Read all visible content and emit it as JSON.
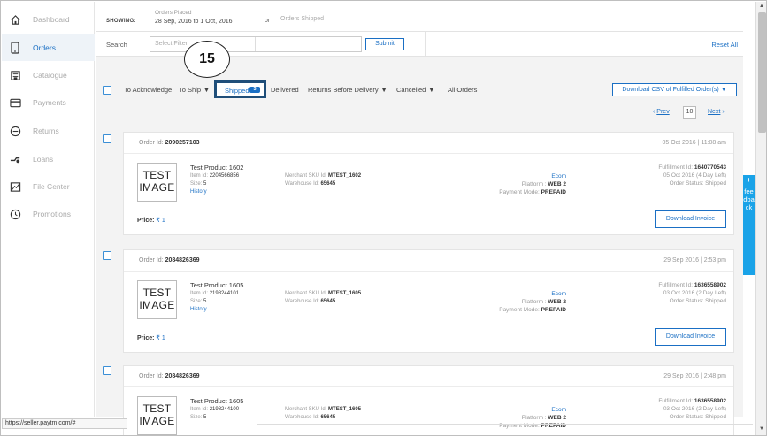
{
  "sidebar": {
    "items": [
      {
        "label": "Dashboard",
        "icon": "home-icon"
      },
      {
        "label": "Orders",
        "icon": "phone-icon",
        "active": true
      },
      {
        "label": "Catalogue",
        "icon": "catalogue-icon"
      },
      {
        "label": "Payments",
        "icon": "card-icon"
      },
      {
        "label": "Returns",
        "icon": "returns-icon"
      },
      {
        "label": "Loans",
        "icon": "loans-icon"
      },
      {
        "label": "File Center",
        "icon": "file-icon"
      },
      {
        "label": "Promotions",
        "icon": "clock-icon"
      }
    ]
  },
  "filters": {
    "showing_label": "SHOWING:",
    "orders_placed_label": "Orders Placed",
    "orders_placed_value": "28 Sep, 2016 to 1 Oct, 2016",
    "or_label": "or",
    "orders_shipped_label": "Orders Shipped"
  },
  "search": {
    "label": "Search",
    "placeholder": "Select Filter",
    "submit_label": "Submit",
    "reset_label": "Reset All"
  },
  "tabs": {
    "to_acknowledge": "To Acknowledge",
    "to_ship": "To Ship",
    "shipped": "Shipped",
    "shipped_count": "3",
    "delivered": "Delivered",
    "returns_before_delivery": "Returns Before Delivery",
    "cancelled": "Cancelled",
    "all_orders": "All Orders",
    "download_csv": "Download CSV of Fulfilled Order(s)"
  },
  "step_marker": "15",
  "pager": {
    "prev": "Prev",
    "page": "10",
    "next": "Next"
  },
  "orders": [
    {
      "order_id_label": "Order Id:",
      "order_id": "2090257103",
      "date": "05 Oct 2016 | 11:08 am",
      "image_line1": "TEST",
      "image_line2": "IMAGE",
      "product_name": "Test Product 1602",
      "item_id_label": "Item Id:",
      "item_id": "2204566856",
      "size_label": "Size:",
      "size": "5",
      "history": "History",
      "wh_sku_label": "Merchant SKU Id:",
      "wh_sku": "MTEST_1602",
      "wh_id_label": "Warehouse Id:",
      "wh_id": "65645",
      "ecom": "Ecom",
      "platform_label": "Platform :",
      "platform": "WEB 2",
      "payment_label": "Payment Mode:",
      "payment": "PREPAID",
      "fulfillment_label": "Fulfillment Id:",
      "fulfillment_id": "1640770543",
      "fulfill_date": "05 Oct 2016 (4 Day Left)",
      "status_label": "Order Status:",
      "status": "Shipped",
      "price_label": "Price:",
      "price_symbol": "₹ 1",
      "invoice": "Download Invoice"
    },
    {
      "order_id_label": "Order Id:",
      "order_id": "2084826369",
      "date": "29 Sep 2016 | 2:53 pm",
      "image_line1": "TEST",
      "image_line2": "IMAGE",
      "product_name": "Test Product 1605",
      "item_id_label": "Item Id:",
      "item_id": "2198244101",
      "size_label": "Size:",
      "size": "5",
      "history": "History",
      "wh_sku_label": "Merchant SKU Id:",
      "wh_sku": "MTEST_1605",
      "wh_id_label": "Warehouse Id:",
      "wh_id": "65645",
      "ecom": "Ecom",
      "platform_label": "Platform :",
      "platform": "WEB 2",
      "payment_label": "Payment Mode:",
      "payment": "PREPAID",
      "fulfillment_label": "Fulfillment Id:",
      "fulfillment_id": "1636558902",
      "fulfill_date": "03 Oct 2016 (2 Day Left)",
      "status_label": "Order Status:",
      "status": "Shipped",
      "price_label": "Price:",
      "price_symbol": "₹ 1",
      "invoice": "Download Invoice"
    },
    {
      "order_id_label": "Order Id:",
      "order_id": "2084826369",
      "date": "29 Sep 2016 | 2:48 pm",
      "image_line1": "TEST",
      "image_line2": "IMAGE",
      "product_name": "Test Product 1605",
      "item_id_label": "Item Id:",
      "item_id": "2198244100",
      "size_label": "Size:",
      "size": "5",
      "wh_sku_label": "Merchant SKU Id:",
      "wh_sku": "MTEST_1605",
      "wh_id_label": "Warehouse Id:",
      "wh_id": "65645",
      "ecom": "Ecom",
      "platform_label": "Platform :",
      "platform": "WEB 2",
      "payment_label": "Payment Mode:",
      "payment": "PREPAID",
      "fulfillment_label": "Fulfillment Id:",
      "fulfillment_id": "1636558902",
      "fulfill_date": "03 Oct 2016 (2 Day Left)",
      "status_label": "Order Status:",
      "status": "Shipped"
    }
  ],
  "feedback": {
    "plus": "+",
    "label": "feedback"
  },
  "status_url": "https://seller.paytm.com/#",
  "colors": {
    "accent": "#1a6fc4",
    "feedback": "#1aa3e8",
    "highlight_border": "#1f4e79"
  }
}
